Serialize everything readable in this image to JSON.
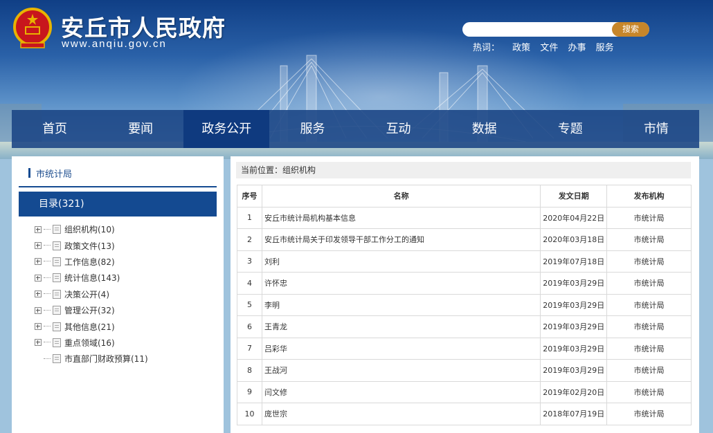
{
  "header": {
    "site_title": "安丘市人民政府",
    "site_url": "www.anqiu.gov.cn",
    "search_placeholder": "",
    "search_button": "搜索",
    "hot_label": "热词：",
    "hot_words": [
      "政策",
      "文件",
      "办事",
      "服务"
    ]
  },
  "nav": {
    "items": [
      "首页",
      "要闻",
      "政务公开",
      "服务",
      "互动",
      "数据",
      "专题",
      "市情"
    ],
    "active_index": 2
  },
  "sidebar": {
    "title": "市统计局",
    "catalog_label": "目录(321)",
    "tree": [
      {
        "label": "组织机构(10)",
        "expandable": true
      },
      {
        "label": "政策文件(13)",
        "expandable": true
      },
      {
        "label": "工作信息(82)",
        "expandable": true
      },
      {
        "label": "统计信息(143)",
        "expandable": true
      },
      {
        "label": "决策公开(4)",
        "expandable": true
      },
      {
        "label": "管理公开(32)",
        "expandable": true
      },
      {
        "label": "其他信息(21)",
        "expandable": true
      },
      {
        "label": "重点领域(16)",
        "expandable": true
      },
      {
        "label": "市直部门财政预算(11)",
        "expandable": false
      }
    ]
  },
  "main": {
    "breadcrumb": "当前位置：组织机构",
    "columns": [
      "序号",
      "名称",
      "发文日期",
      "发布机构"
    ],
    "rows": [
      [
        "1",
        "安丘市统计局机构基本信息",
        "2020年04月22日",
        "市统计局"
      ],
      [
        "2",
        "安丘市统计局关于印发领导干部工作分工的通知",
        "2020年03月18日",
        "市统计局"
      ],
      [
        "3",
        "刘利",
        "2019年07月18日",
        "市统计局"
      ],
      [
        "4",
        "许怀忠",
        "2019年03月29日",
        "市统计局"
      ],
      [
        "5",
        "李明",
        "2019年03月29日",
        "市统计局"
      ],
      [
        "6",
        "王青龙",
        "2019年03月29日",
        "市统计局"
      ],
      [
        "7",
        "吕彩华",
        "2019年03月29日",
        "市统计局"
      ],
      [
        "8",
        "王战河",
        "2019年03月29日",
        "市统计局"
      ],
      [
        "9",
        "闫文修",
        "2019年02月20日",
        "市统计局"
      ],
      [
        "10",
        "庞世宗",
        "2018年07月19日",
        "市统计局"
      ]
    ]
  },
  "colors": {
    "nav_bg": "#1a4484",
    "nav_active": "#0f3a7f",
    "accent_blue": "#144a91",
    "search_button": "#c7862a",
    "emblem_red": "#c8161d",
    "emblem_gold": "#e8b300"
  }
}
